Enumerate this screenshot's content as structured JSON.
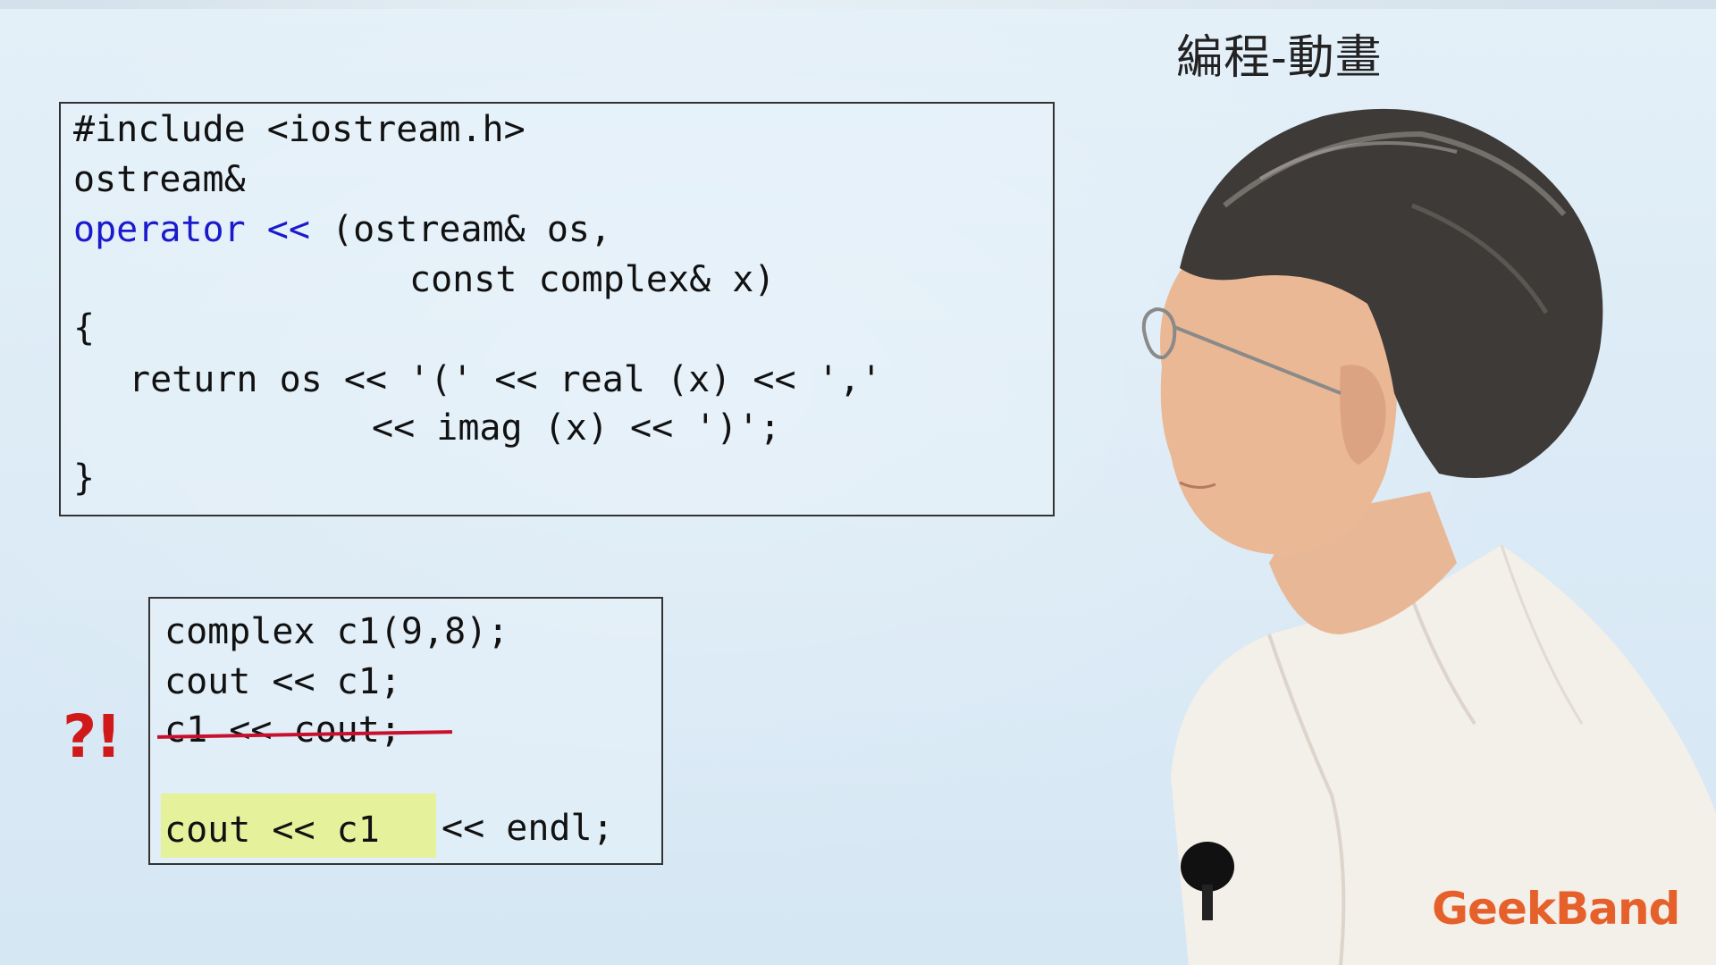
{
  "caption": "編程-動畫",
  "code_main": {
    "line1": "#include <iostream.h>",
    "line2": "ostream&",
    "line3_kw_operator": "operator",
    "line3_kw_shift": "<<",
    "line3_rest": "(ostream& os,",
    "line4": "const complex& x)",
    "line5": "{",
    "line6": "return os << '(' << real (x) << ','",
    "line7": "<< imag (x) << ')';",
    "line8": "}"
  },
  "code_usage": {
    "line1": "complex c1(9,8);",
    "line2": "cout << c1;",
    "line3_struck": "c1 << cout;",
    "line4_highlighted": "cout << c1",
    "line4_rest": "<< endl;"
  },
  "marker": "?!",
  "logo": "GeekBand",
  "colors": {
    "keyword": "#1a1acc",
    "strike": "#c8102e",
    "highlight": "#e4f02a",
    "marker": "#d01a1a",
    "logo": "#e5602a"
  }
}
